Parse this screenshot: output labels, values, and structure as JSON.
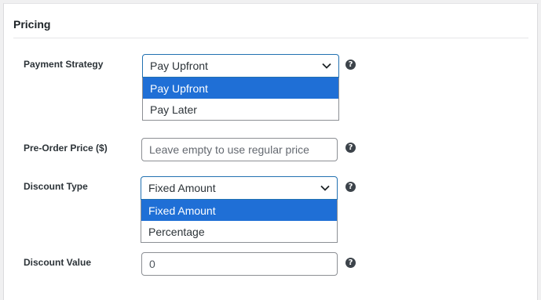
{
  "section": {
    "title": "Pricing"
  },
  "payment_strategy": {
    "label": "Payment Strategy",
    "value": "Pay Upfront",
    "options": [
      "Pay Upfront",
      "Pay Later"
    ]
  },
  "pre_order_price": {
    "label": "Pre-Order Price ($)",
    "placeholder": "Leave empty to use regular price"
  },
  "discount_type": {
    "label": "Discount Type",
    "value": "Fixed Amount",
    "options": [
      "Fixed Amount",
      "Percentage"
    ]
  },
  "discount_value": {
    "label": "Discount Value",
    "value": "0"
  },
  "help_icon": {
    "glyph": "?"
  }
}
